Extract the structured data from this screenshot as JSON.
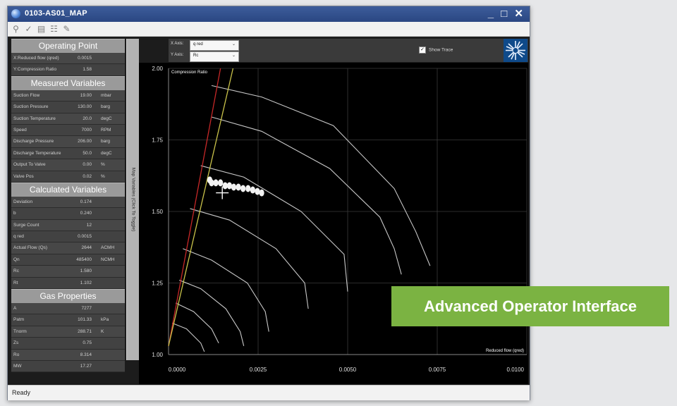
{
  "window": {
    "title": "0103-AS01_MAP",
    "controls": "_ □ ✕"
  },
  "toolbar": {
    "icons": [
      "search-icon",
      "check-icon",
      "print-icon",
      "tree-icon",
      "edit-icon"
    ]
  },
  "left": {
    "sections": [
      {
        "title": "Operating Point",
        "rows": [
          {
            "label": "X:Reduced flow (qred)",
            "value": "0.0015",
            "unit": ""
          },
          {
            "label": "Y:Compression Ratio",
            "value": "1.58",
            "unit": ""
          }
        ]
      },
      {
        "title": "Measured Variables",
        "rows": [
          {
            "label": "Suction Flow",
            "value": "19.00",
            "unit": "mbar"
          },
          {
            "label": "Suction Pressure",
            "value": "130.00",
            "unit": "barg"
          },
          {
            "label": "Suction Temperature",
            "value": "20.0",
            "unit": "degC"
          },
          {
            "label": "Speed",
            "value": "7000",
            "unit": "RPM"
          },
          {
            "label": "Discharge Pressure",
            "value": "206.00",
            "unit": "barg"
          },
          {
            "label": "Discharge Temperature",
            "value": "50.0",
            "unit": "degC"
          },
          {
            "label": "Output To Valve",
            "value": "0.00",
            "unit": "%"
          },
          {
            "label": "Valve Pos",
            "value": "0.02",
            "unit": "%"
          }
        ]
      },
      {
        "title": "Calculated Variables",
        "rows": [
          {
            "label": "Deviation",
            "value": "0.174",
            "unit": ""
          },
          {
            "label": "b",
            "value": "0.240",
            "unit": ""
          },
          {
            "label": "Surge Count",
            "value": "12",
            "unit": ""
          },
          {
            "label": "q red",
            "value": "0.0015",
            "unit": ""
          },
          {
            "label": "Actual Flow (Qs)",
            "value": "2644",
            "unit": "ACMH"
          },
          {
            "label": "Qn",
            "value": "485400",
            "unit": "NCMH"
          },
          {
            "label": "Rc",
            "value": "1.580",
            "unit": ""
          },
          {
            "label": "Rt",
            "value": "1.102",
            "unit": ""
          }
        ]
      },
      {
        "title": "Gas Properties",
        "rows": [
          {
            "label": "A",
            "value": "7277",
            "unit": ""
          },
          {
            "label": "Patm",
            "value": "101.33",
            "unit": "kPa"
          },
          {
            "label": "Tnorm",
            "value": "288.71",
            "unit": "K"
          },
          {
            "label": "Zs",
            "value": "0.75",
            "unit": ""
          },
          {
            "label": "Ro",
            "value": "8.314",
            "unit": ""
          },
          {
            "label": "MW",
            "value": "17.27",
            "unit": ""
          }
        ]
      }
    ]
  },
  "vtab": {
    "label": "Map Variables (Click To Toggle)"
  },
  "axes_ctrl": {
    "x_label": "X Axis:",
    "x_value": "q red",
    "y_label": "Y Axis:",
    "y_value": "Rc",
    "show_trace": "Show Trace",
    "show_trace_checked": true
  },
  "status": "Ready",
  "banner": "Advanced Operator Interface",
  "colors": {
    "surge_line": "#c62828",
    "control_line": "#c9c24a",
    "speed_lines": "#c8c8c8",
    "banner": "#7bb342"
  },
  "chart_data": {
    "type": "line",
    "title": "Compression Ratio",
    "xlabel": "Reduced flow (qred)",
    "ylabel": "Compression Ratio",
    "xlim": [
      0,
      0.01
    ],
    "ylim": [
      1.0,
      2.0
    ],
    "x_ticks": [
      "0.0000",
      "0.0025",
      "0.0050",
      "0.0075",
      "0.0100"
    ],
    "y_ticks": [
      "1.00",
      "1.25",
      "1.50",
      "1.75",
      "2.00"
    ],
    "grid": true,
    "surge_line": [
      [
        0,
        1.03
      ],
      [
        0.00145,
        2.0
      ]
    ],
    "control_line": [
      [
        0,
        1.03
      ],
      [
        0.0018,
        2.0
      ]
    ],
    "speed_lines": [
      [
        [
          0.0012,
          1.94
        ],
        [
          0.0026,
          1.9
        ],
        [
          0.0046,
          1.8
        ],
        [
          0.0063,
          1.58
        ],
        [
          0.0069,
          1.43
        ],
        [
          0.0073,
          1.31
        ]
      ],
      [
        [
          0.0012,
          1.83
        ],
        [
          0.0026,
          1.78
        ],
        [
          0.0045,
          1.65
        ],
        [
          0.0059,
          1.48
        ],
        [
          0.0063,
          1.37
        ],
        [
          0.0065,
          1.28
        ]
      ],
      [
        [
          0.0009,
          1.66
        ],
        [
          0.0021,
          1.62
        ],
        [
          0.0037,
          1.5
        ],
        [
          0.0049,
          1.35
        ],
        [
          0.005,
          1.22
        ]
      ],
      [
        [
          0.0006,
          1.51
        ],
        [
          0.0017,
          1.47
        ],
        [
          0.003,
          1.37
        ],
        [
          0.0038,
          1.25
        ],
        [
          0.0039,
          1.16
        ]
      ],
      [
        [
          0.0004,
          1.37
        ],
        [
          0.0012,
          1.33
        ],
        [
          0.0022,
          1.25
        ],
        [
          0.0027,
          1.15
        ],
        [
          0.0028,
          1.08
        ]
      ],
      [
        [
          0.0003,
          1.26
        ],
        [
          0.0009,
          1.23
        ],
        [
          0.0016,
          1.16
        ],
        [
          0.002,
          1.08
        ],
        [
          0.0021,
          1.03
        ]
      ],
      [
        [
          0.0002,
          1.18
        ],
        [
          0.0007,
          1.15
        ],
        [
          0.0012,
          1.09
        ],
        [
          0.0014,
          1.04
        ]
      ],
      [
        [
          0.0001,
          1.11
        ],
        [
          0.0005,
          1.09
        ],
        [
          0.0009,
          1.04
        ],
        [
          0.001,
          1.01
        ]
      ]
    ],
    "trace": [
      [
        0.00115,
        1.61
      ],
      [
        0.0012,
        1.6
      ],
      [
        0.00132,
        1.6
      ],
      [
        0.00145,
        1.6
      ],
      [
        0.00158,
        1.59
      ],
      [
        0.0017,
        1.59
      ],
      [
        0.00182,
        1.585
      ],
      [
        0.00195,
        1.585
      ],
      [
        0.00208,
        1.58
      ],
      [
        0.00222,
        1.58
      ],
      [
        0.00235,
        1.575
      ],
      [
        0.00248,
        1.57
      ],
      [
        0.0026,
        1.565
      ]
    ],
    "operating_point": [
      0.0015,
      1.58
    ]
  }
}
